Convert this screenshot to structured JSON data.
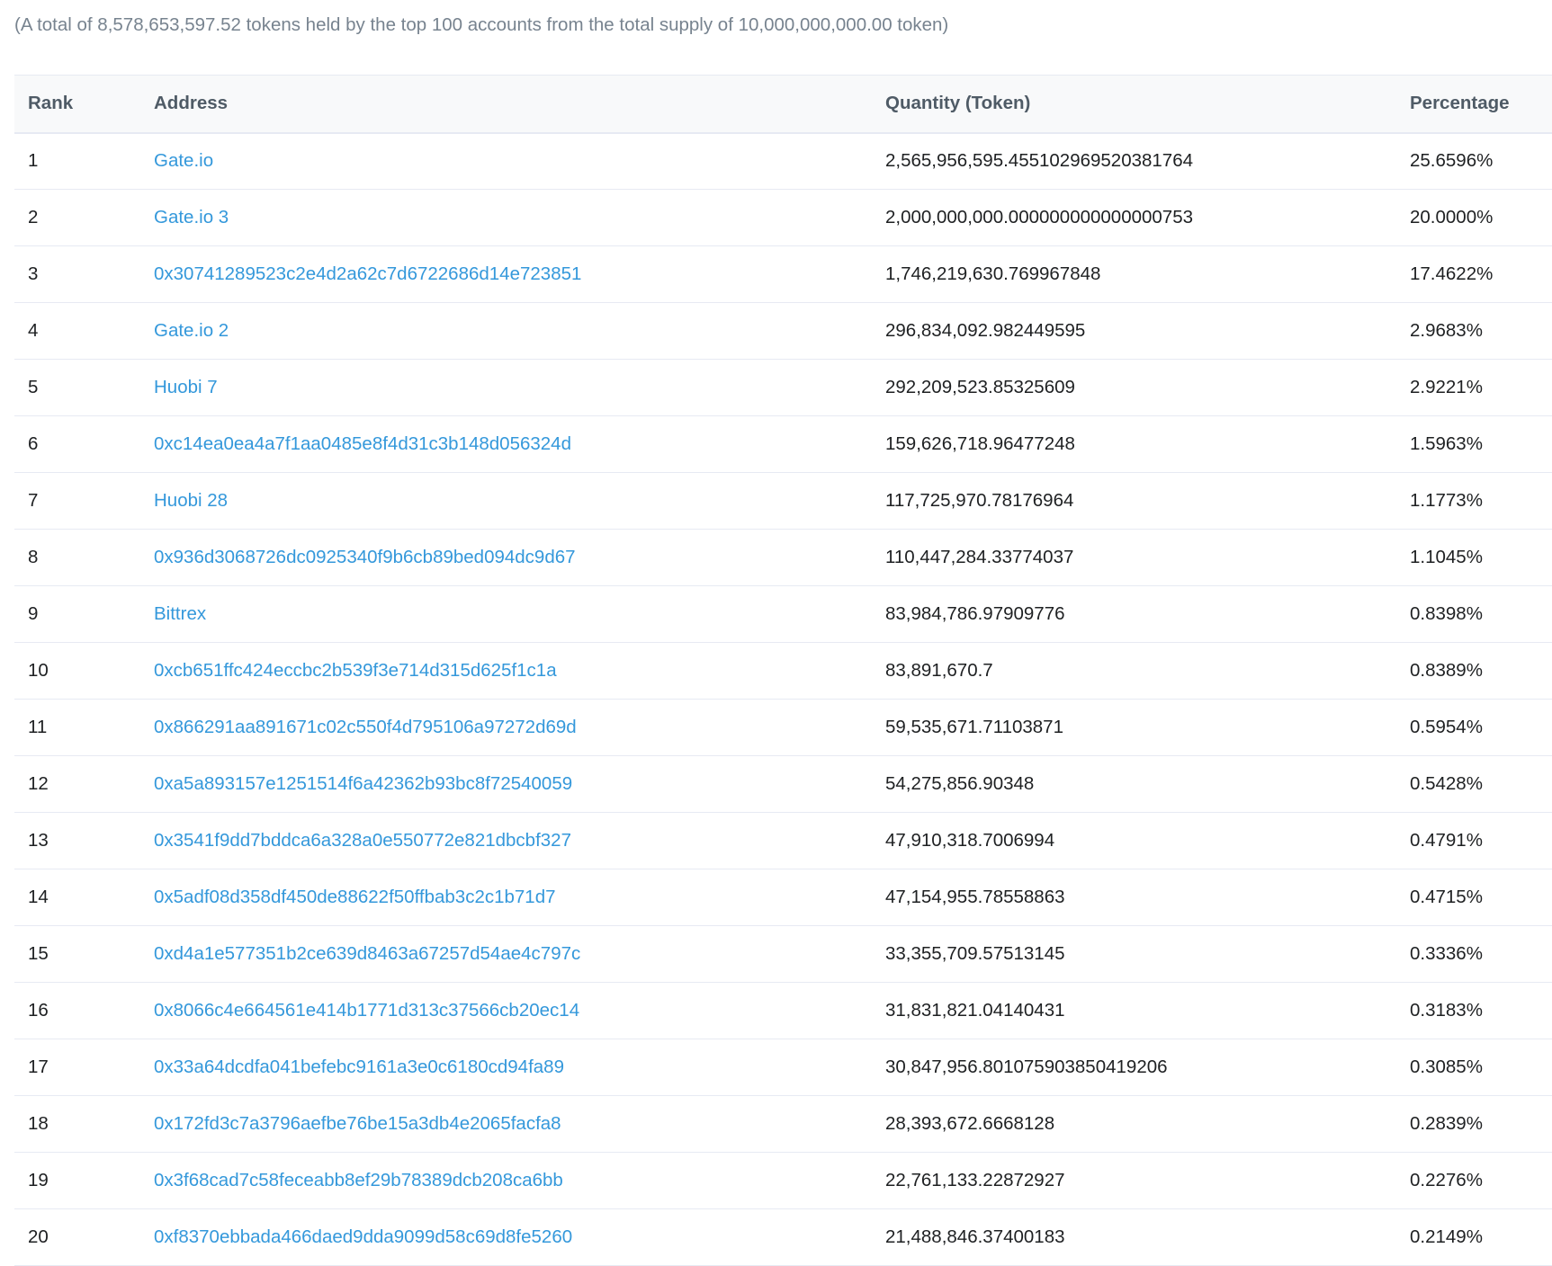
{
  "summary": "(A total of 8,578,653,597.52 tokens held by the top 100 accounts from the total supply of 10,000,000,000.00 token)",
  "table": {
    "headers": {
      "rank": "Rank",
      "address": "Address",
      "quantity": "Quantity (Token)",
      "percentage": "Percentage"
    },
    "rows": [
      {
        "rank": "1",
        "address": "Gate.io",
        "quantity": "2,565,956,595.455102969520381764",
        "percentage": "25.6596%"
      },
      {
        "rank": "2",
        "address": "Gate.io 3",
        "quantity": "2,000,000,000.000000000000000753",
        "percentage": "20.0000%"
      },
      {
        "rank": "3",
        "address": "0x30741289523c2e4d2a62c7d6722686d14e723851",
        "quantity": "1,746,219,630.769967848",
        "percentage": "17.4622%"
      },
      {
        "rank": "4",
        "address": "Gate.io 2",
        "quantity": "296,834,092.982449595",
        "percentage": "2.9683%"
      },
      {
        "rank": "5",
        "address": "Huobi 7",
        "quantity": "292,209,523.85325609",
        "percentage": "2.9221%"
      },
      {
        "rank": "6",
        "address": "0xc14ea0ea4a7f1aa0485e8f4d31c3b148d056324d",
        "quantity": "159,626,718.96477248",
        "percentage": "1.5963%"
      },
      {
        "rank": "7",
        "address": "Huobi 28",
        "quantity": "117,725,970.78176964",
        "percentage": "1.1773%"
      },
      {
        "rank": "8",
        "address": "0x936d3068726dc0925340f9b6cb89bed094dc9d67",
        "quantity": "110,447,284.33774037",
        "percentage": "1.1045%"
      },
      {
        "rank": "9",
        "address": "Bittrex",
        "quantity": "83,984,786.97909776",
        "percentage": "0.8398%"
      },
      {
        "rank": "10",
        "address": "0xcb651ffc424eccbc2b539f3e714d315d625f1c1a",
        "quantity": "83,891,670.7",
        "percentage": "0.8389%"
      },
      {
        "rank": "11",
        "address": "0x866291aa891671c02c550f4d795106a97272d69d",
        "quantity": "59,535,671.71103871",
        "percentage": "0.5954%"
      },
      {
        "rank": "12",
        "address": "0xa5a893157e1251514f6a42362b93bc8f72540059",
        "quantity": "54,275,856.90348",
        "percentage": "0.5428%"
      },
      {
        "rank": "13",
        "address": "0x3541f9dd7bddca6a328a0e550772e821dbcbf327",
        "quantity": "47,910,318.7006994",
        "percentage": "0.4791%"
      },
      {
        "rank": "14",
        "address": "0x5adf08d358df450de88622f50ffbab3c2c1b71d7",
        "quantity": "47,154,955.78558863",
        "percentage": "0.4715%"
      },
      {
        "rank": "15",
        "address": "0xd4a1e577351b2ce639d8463a67257d54ae4c797c",
        "quantity": "33,355,709.57513145",
        "percentage": "0.3336%"
      },
      {
        "rank": "16",
        "address": "0x8066c4e664561e414b1771d313c37566cb20ec14",
        "quantity": "31,831,821.04140431",
        "percentage": "0.3183%"
      },
      {
        "rank": "17",
        "address": "0x33a64dcdfa041befebc9161a3e0c6180cd94fa89",
        "quantity": "30,847,956.801075903850419206",
        "percentage": "0.3085%"
      },
      {
        "rank": "18",
        "address": "0x172fd3c7a3796aefbe76be15a3db4e2065facfa8",
        "quantity": "28,393,672.6668128",
        "percentage": "0.2839%"
      },
      {
        "rank": "19",
        "address": "0x3f68cad7c58feceabb8ef29b78389dcb208ca6bb",
        "quantity": "22,761,133.22872927",
        "percentage": "0.2276%"
      },
      {
        "rank": "20",
        "address": "0xf8370ebbada466daed9dda9099d58c69d8fe5260",
        "quantity": "21,488,846.37400183",
        "percentage": "0.2149%"
      }
    ]
  },
  "colors": {
    "link": "#3498db",
    "muted_text": "#77838f",
    "header_bg": "#f8f9fa",
    "border": "#e7eaf3"
  }
}
